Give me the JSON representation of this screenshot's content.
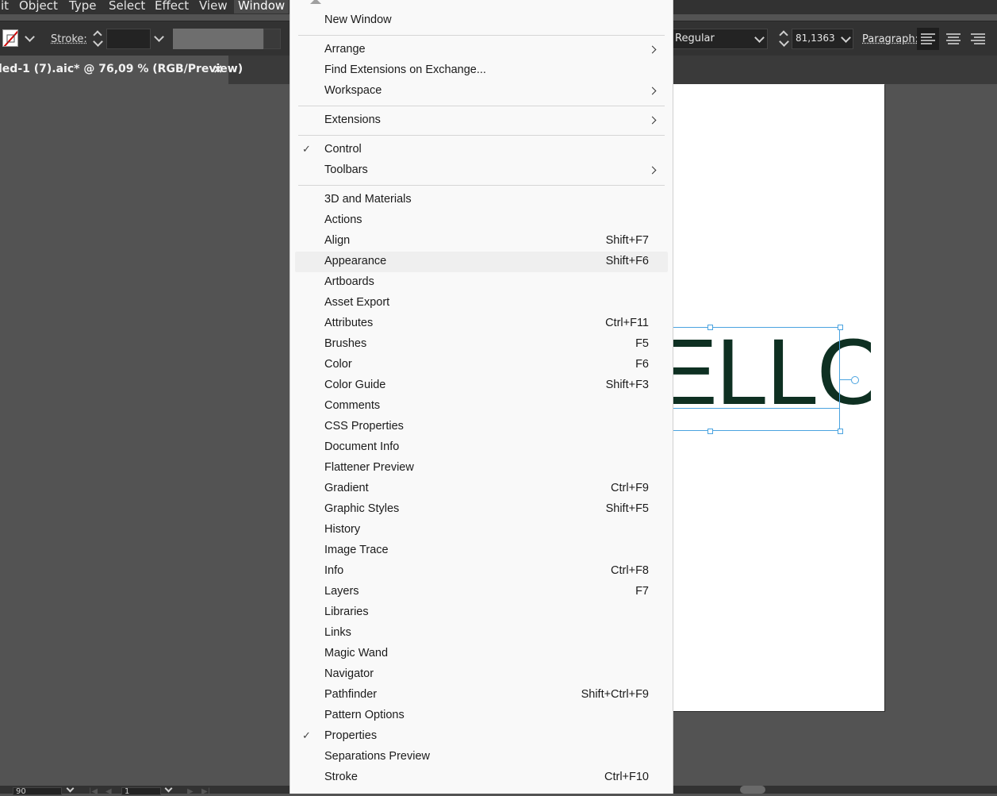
{
  "menubar": {
    "items": [
      "it",
      "Object",
      "Type",
      "Select",
      "Effect",
      "View",
      "Window"
    ],
    "active": "Window"
  },
  "control_bar": {
    "stroke_label": "Stroke:",
    "font_style": "Regular",
    "font_size": "81,1363",
    "paragraph_label": "Paragraph:"
  },
  "document_tab": {
    "title": "led-1 (7).aic* @ 76,09 % (RGB/Preview)",
    "close_glyph": "×"
  },
  "artboard": {
    "text": "ELLO",
    "text_color": "#0e3022"
  },
  "statusbar": {
    "zoom": "90",
    "artboard_number": "1"
  },
  "window_menu": {
    "items": [
      {
        "label": "New Window",
        "shortcut": "",
        "submenu": false,
        "checked": false
      },
      {
        "label": "Arrange",
        "shortcut": "",
        "submenu": true,
        "checked": false
      },
      {
        "label": "Find Extensions on Exchange...",
        "shortcut": "",
        "submenu": false,
        "checked": false
      },
      {
        "label": "Workspace",
        "shortcut": "",
        "submenu": true,
        "checked": false
      },
      {
        "label": "Extensions",
        "shortcut": "",
        "submenu": true,
        "checked": false
      },
      {
        "label": "Control",
        "shortcut": "",
        "submenu": false,
        "checked": true
      },
      {
        "label": "Toolbars",
        "shortcut": "",
        "submenu": true,
        "checked": false
      },
      {
        "label": "3D and Materials",
        "shortcut": "",
        "submenu": false,
        "checked": false
      },
      {
        "label": "Actions",
        "shortcut": "",
        "submenu": false,
        "checked": false
      },
      {
        "label": "Align",
        "shortcut": "Shift+F7",
        "submenu": false,
        "checked": false
      },
      {
        "label": "Appearance",
        "shortcut": "Shift+F6",
        "submenu": false,
        "checked": false,
        "highlighted": true
      },
      {
        "label": "Artboards",
        "shortcut": "",
        "submenu": false,
        "checked": false
      },
      {
        "label": "Asset Export",
        "shortcut": "",
        "submenu": false,
        "checked": false
      },
      {
        "label": "Attributes",
        "shortcut": "Ctrl+F11",
        "submenu": false,
        "checked": false
      },
      {
        "label": "Brushes",
        "shortcut": "F5",
        "submenu": false,
        "checked": false
      },
      {
        "label": "Color",
        "shortcut": "F6",
        "submenu": false,
        "checked": false
      },
      {
        "label": "Color Guide",
        "shortcut": "Shift+F3",
        "submenu": false,
        "checked": false
      },
      {
        "label": "Comments",
        "shortcut": "",
        "submenu": false,
        "checked": false
      },
      {
        "label": "CSS Properties",
        "shortcut": "",
        "submenu": false,
        "checked": false
      },
      {
        "label": "Document Info",
        "shortcut": "",
        "submenu": false,
        "checked": false
      },
      {
        "label": "Flattener Preview",
        "shortcut": "",
        "submenu": false,
        "checked": false
      },
      {
        "label": "Gradient",
        "shortcut": "Ctrl+F9",
        "submenu": false,
        "checked": false
      },
      {
        "label": "Graphic Styles",
        "shortcut": "Shift+F5",
        "submenu": false,
        "checked": false
      },
      {
        "label": "History",
        "shortcut": "",
        "submenu": false,
        "checked": false
      },
      {
        "label": "Image Trace",
        "shortcut": "",
        "submenu": false,
        "checked": false
      },
      {
        "label": "Info",
        "shortcut": "Ctrl+F8",
        "submenu": false,
        "checked": false
      },
      {
        "label": "Layers",
        "shortcut": "F7",
        "submenu": false,
        "checked": false
      },
      {
        "label": "Libraries",
        "shortcut": "",
        "submenu": false,
        "checked": false
      },
      {
        "label": "Links",
        "shortcut": "",
        "submenu": false,
        "checked": false
      },
      {
        "label": "Magic Wand",
        "shortcut": "",
        "submenu": false,
        "checked": false
      },
      {
        "label": "Navigator",
        "shortcut": "",
        "submenu": false,
        "checked": false
      },
      {
        "label": "Pathfinder",
        "shortcut": "Shift+Ctrl+F9",
        "submenu": false,
        "checked": false
      },
      {
        "label": "Pattern Options",
        "shortcut": "",
        "submenu": false,
        "checked": false
      },
      {
        "label": "Properties",
        "shortcut": "",
        "submenu": false,
        "checked": true
      },
      {
        "label": "Separations Preview",
        "shortcut": "",
        "submenu": false,
        "checked": false
      },
      {
        "label": "Stroke",
        "shortcut": "Ctrl+F10",
        "submenu": false,
        "checked": false
      }
    ]
  },
  "colors": {
    "app_chrome": "#323232",
    "canvas": "#535353",
    "menu_bg": "#f9f9f9",
    "selection": "#4aa3e0"
  }
}
